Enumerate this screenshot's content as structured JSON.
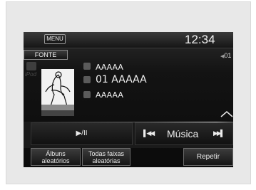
{
  "header": {
    "menu_label": "MENU",
    "clock": "12:34"
  },
  "source": {
    "fonte_label": "FONTE",
    "device_label": "iPod",
    "disc_number": "01"
  },
  "track_info": {
    "artist": "AAAAA",
    "track": "01 AAAAA",
    "album": "AAAAA"
  },
  "controls": {
    "play_pause": "▶/II",
    "category": "Música",
    "prev_icon": "skip-previous-icon",
    "next_icon": "skip-next-icon"
  },
  "bottom_buttons": {
    "shuffle_albums_line1": "Álbuns",
    "shuffle_albums_line2": "aleatórios",
    "shuffle_all_line1": "Todas faixas",
    "shuffle_all_line2": "aleatórias",
    "repeat": "Repetir"
  },
  "colors": {
    "screen_bg": "#111111",
    "text": "#f1f1f1",
    "frame_bg": "#e8e8e8"
  }
}
